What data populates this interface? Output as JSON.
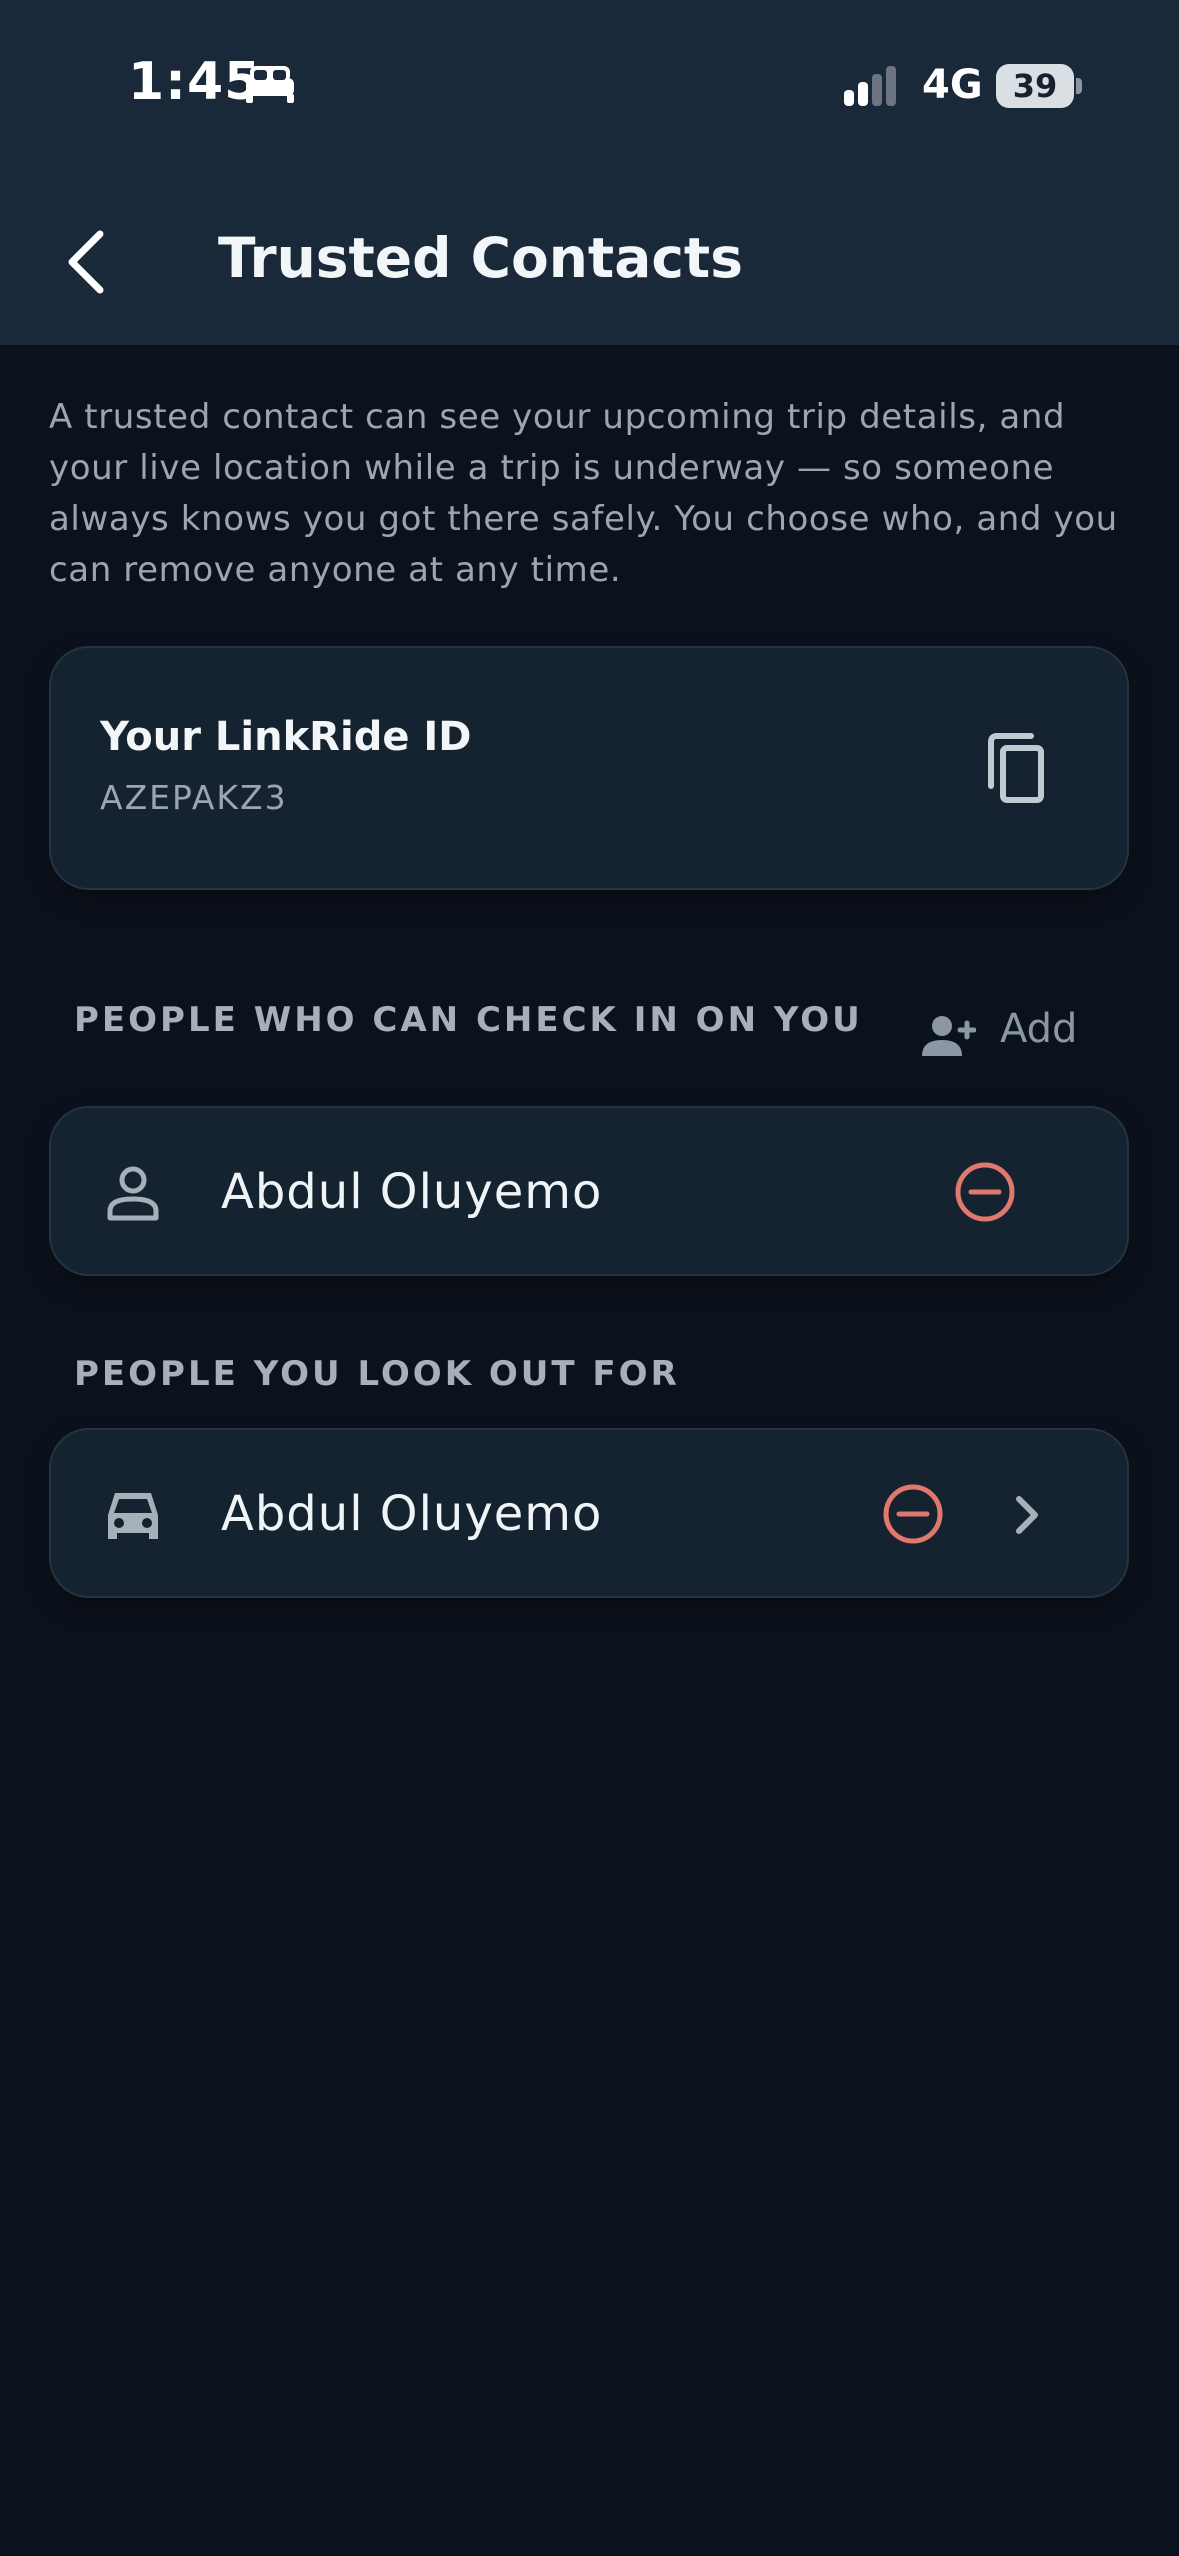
{
  "status_bar": {
    "time": "1:45",
    "network": "4G",
    "battery": "39"
  },
  "header": {
    "title": "Trusted Contacts"
  },
  "description": "A trusted contact can see your upcoming trip details, and your live location while a trip is underway — so someone always knows you got there safely. You choose who, and you can remove anyone at any time.",
  "id_card": {
    "title": "Your LinkRide ID",
    "value": "AZEPAKZ3"
  },
  "section_check_in": {
    "label": "PEOPLE WHO CAN CHECK IN ON YOU",
    "add_label": "Add",
    "contacts": [
      {
        "name": "Abdul Oluyemo"
      }
    ]
  },
  "section_look_out": {
    "label": "PEOPLE YOU LOOK OUT FOR",
    "contacts": [
      {
        "name": "Abdul Oluyemo"
      }
    ]
  },
  "colors": {
    "header_bg": "#19293a",
    "page_bg": "#0c121d",
    "card_bg": "#15222f",
    "remove_accent": "#e0786e"
  }
}
